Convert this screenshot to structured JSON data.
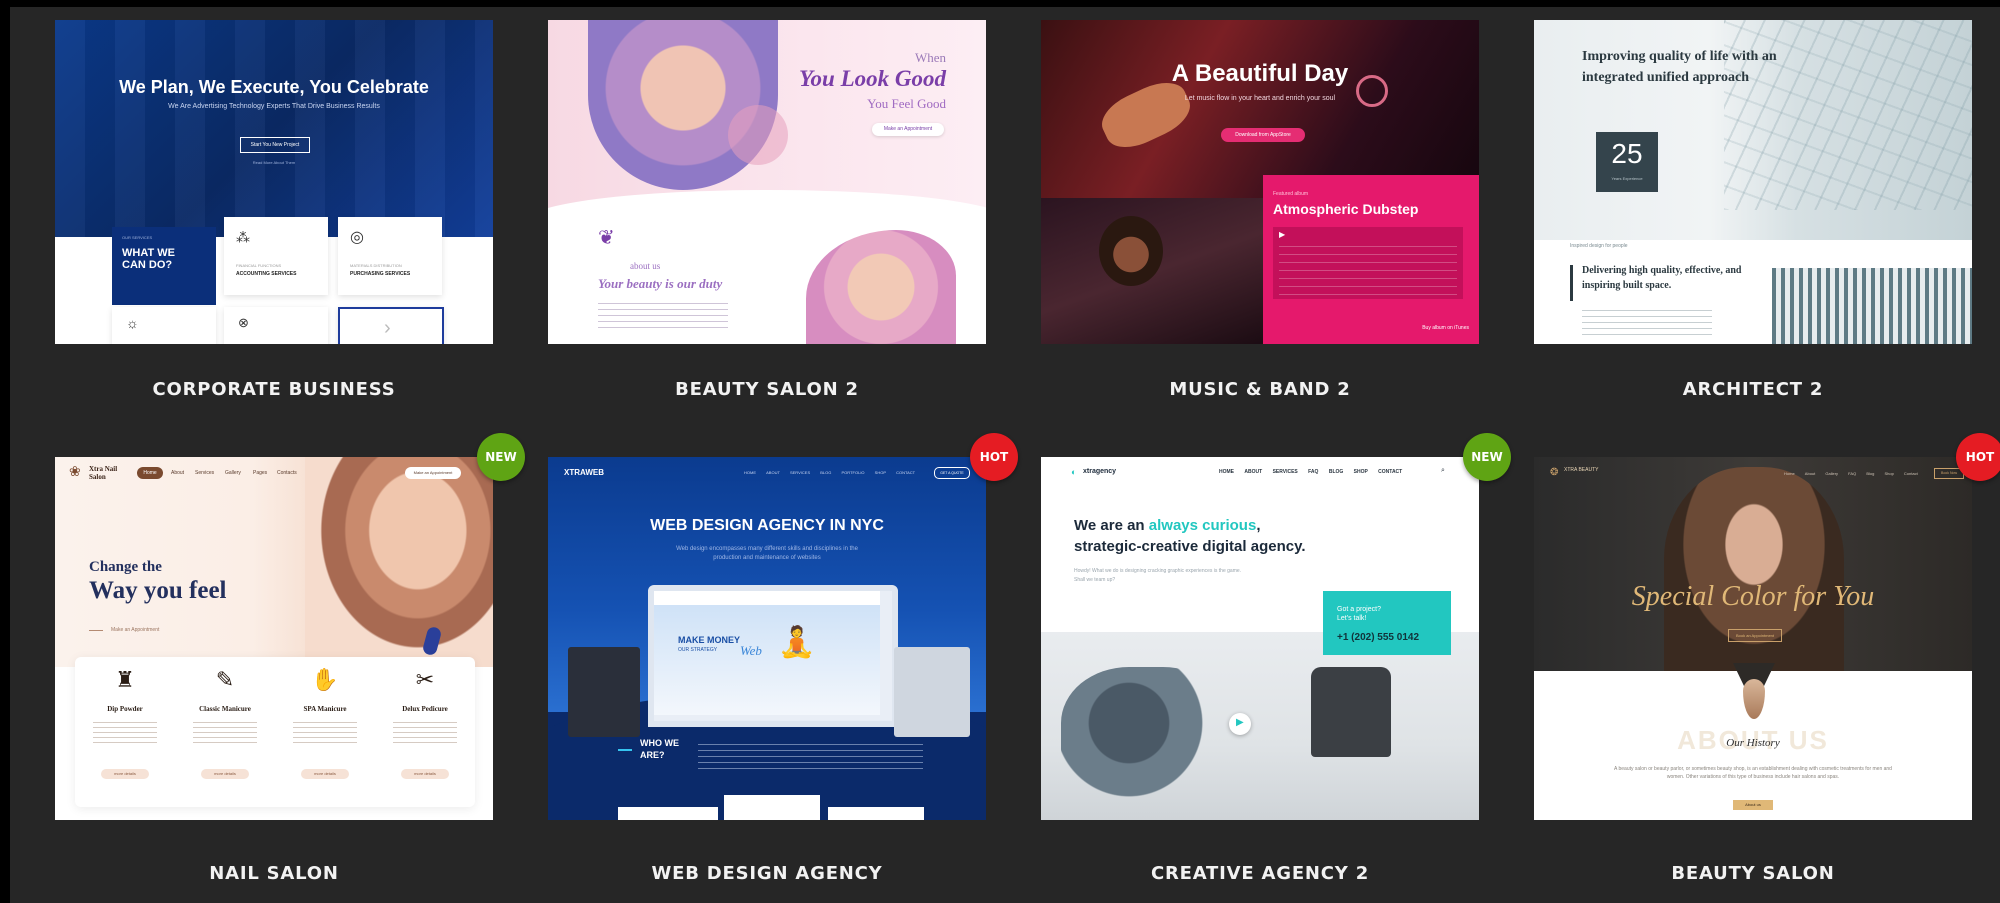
{
  "colors": {
    "background": "#262626",
    "new_badge": "#5fa414",
    "hot_badge": "#e51c23",
    "card_title": "#f2f2f2"
  },
  "cards": [
    {
      "title": "CORPORATE BUSINESS",
      "preview": {
        "headline": "We Plan, We Execute, You Celebrate",
        "subheadline": "We Are Advertising Technology Experts That Drive Business Results",
        "cta": "Start You New Project",
        "link": "Read More About Them",
        "services_label": "OUR SERVICES",
        "what_we_can_do": "WHAT WE CAN DO?",
        "service_1_kicker": "FINANCIAL FUNCTIONS",
        "service_1": "ACCOUNTING SERVICES",
        "service_2_kicker": "MATERIALS DISTRIBUTION",
        "service_2": "PURCHASING SERVICES"
      }
    },
    {
      "title": "BEAUTY SALON 2",
      "preview": {
        "kicker": "When",
        "headline": "You Look Good",
        "subheadline": "You Feel Good",
        "cta": "Make an Appointment",
        "about_label": "about us",
        "about_title": "Your beauty is our duty"
      }
    },
    {
      "title": "MUSIC & BAND 2",
      "preview": {
        "headline": "A Beautiful Day",
        "subheadline": "Let music flow in your heart and enrich your soul",
        "cta": "Download from AppStore",
        "album_kicker": "Featured album",
        "album_title": "Atmospheric Dubstep",
        "buy_link": "Buy album on iTunes"
      }
    },
    {
      "title": "ARCHITECT 2",
      "preview": {
        "headline": "Improving quality of life with an integrated unified approach",
        "years_number": "25",
        "years_label": "Years Experience",
        "kicker": "Inspired design for people",
        "subheadline": "Delivering high quality, effective, and inspiring built space."
      }
    },
    {
      "title": "NAIL SALON",
      "badge": "NEW",
      "preview": {
        "logo": "Xtra Nail Salon",
        "nav": [
          "Home",
          "About",
          "Services",
          "Gallery",
          "Pages",
          "Contacts"
        ],
        "nav_cta": "Make an Appointment",
        "headline_1": "Change the",
        "headline_2": "Way you feel",
        "link": "Make an Appointment",
        "services": [
          {
            "icon": "nail-polish-icon",
            "name": "Dip Powder",
            "button": "more details"
          },
          {
            "icon": "nail-file-icon",
            "name": "Classic Manicure",
            "button": "more details"
          },
          {
            "icon": "hand-icon",
            "name": "SPA Manicure",
            "button": "more details"
          },
          {
            "icon": "scissors-icon",
            "name": "Delux Pedicure",
            "button": "more details"
          }
        ]
      }
    },
    {
      "title": "WEB DESIGN AGENCY",
      "badge": "HOT",
      "preview": {
        "logo": "XTRAWEB",
        "nav": [
          "HOME",
          "ABOUT",
          "SERVICES",
          "BLOG",
          "PORTFOLIO",
          "SHOP",
          "CONTACT"
        ],
        "nav_cta": "GET A QUOTE",
        "headline": "WEB DESIGN AGENCY IN NYC",
        "subheadline": "Web design encompasses many different skills and disciplines in the production and maintenance of websites",
        "screen_text": "MAKE MONEY",
        "screen_subtext": "OUR STRATEGY",
        "screen_script": "Web",
        "who_title": "WHO WE ARE?"
      }
    },
    {
      "title": "CREATIVE AGENCY 2",
      "badge": "NEW",
      "preview": {
        "logo": "xtragency",
        "nav": [
          "HOME",
          "ABOUT",
          "SERVICES",
          "FAQ",
          "BLOG",
          "SHOP",
          "CONTACT"
        ],
        "headline_pre": "We are an",
        "headline_accent": "always curious",
        "headline_post": ",",
        "headline_2": "strategic-creative digital agency.",
        "body": "Howdy! What we do is designing cracking graphic experiences is the game. Shall we team up?",
        "project_label": "Got a project? Let's talk!",
        "phone": "+1 (202) 555 0142"
      }
    },
    {
      "title": "BEAUTY SALON",
      "badge": "HOT",
      "preview": {
        "logo": "XTRA BEAUTY",
        "nav": [
          "Home",
          "About",
          "Gallery",
          "FAQ",
          "Blog",
          "Shop",
          "Contact"
        ],
        "nav_cta": "Book Now",
        "headline": "Special Color for You",
        "cta": "Book an Appointment",
        "about_bg": "ABOUT US",
        "about_title": "Our History",
        "body": "A beauty salon or beauty parlor, or sometimes beauty shop, is an establishment dealing with cosmetic treatments for men and women. Other variations of this type of business include hair salons and spas.",
        "button": "About us"
      }
    }
  ]
}
